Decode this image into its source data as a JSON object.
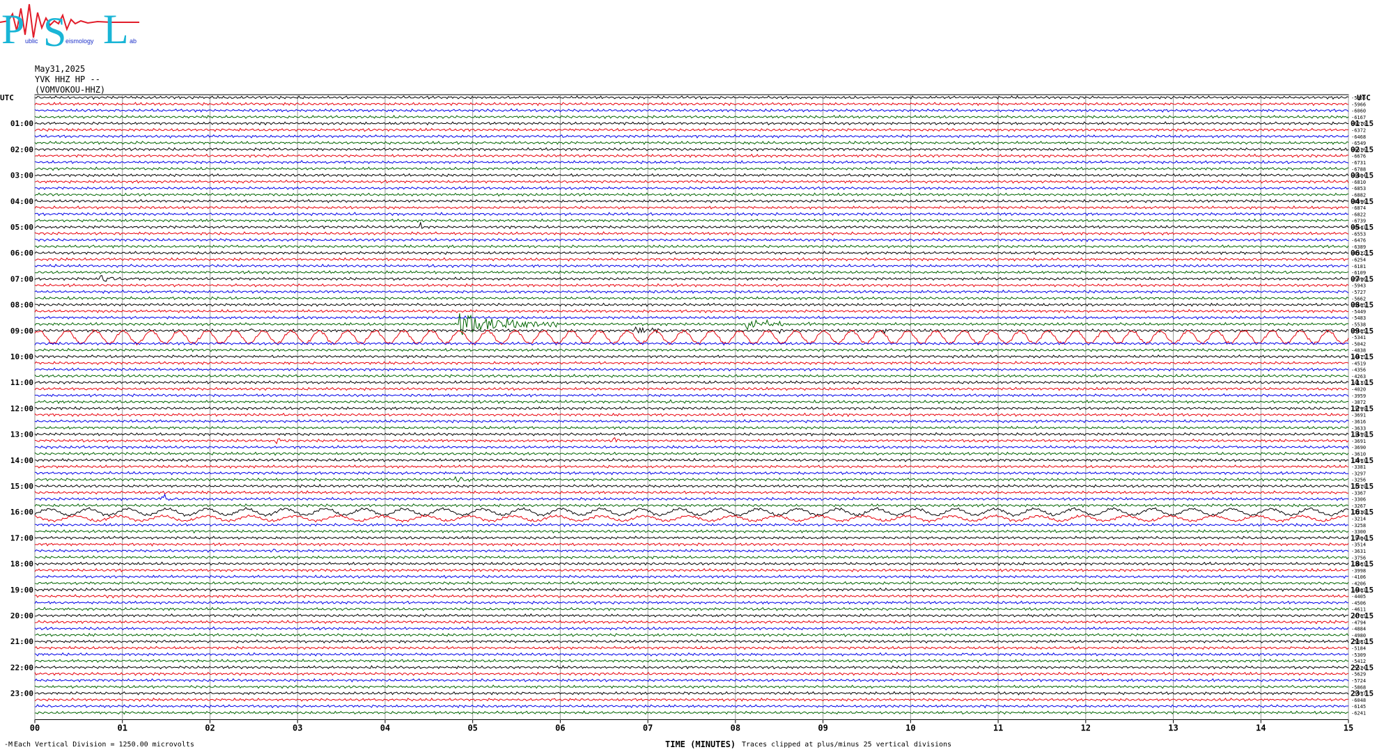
{
  "logo": {
    "big_letters": [
      "P",
      "S",
      "L"
    ],
    "small_text": [
      "ublic",
      "eismology",
      "ab"
    ],
    "colors": {
      "letters": "#19b5d6",
      "small": "#1b2fc9",
      "wave": "#e11d2a"
    }
  },
  "header": {
    "date": "May31,2025",
    "station": "YVK HHZ HP --",
    "code": "(VOMVOKOU-HHZ)"
  },
  "footer": {
    "xlabel": "TIME (MINUTES)",
    "scale_note": "Each Vertical Division = 1250.00 microvolts",
    "clip_note": "Traces clipped at plus/minus 25 vertical divisions",
    "corner_mark": "-M"
  },
  "chart_data": {
    "type": "line",
    "title": "",
    "xlabel": "TIME (MINUTES)",
    "ylabel": "UTC",
    "x_ticks": [
      "00",
      "01",
      "02",
      "03",
      "04",
      "05",
      "06",
      "07",
      "08",
      "09",
      "10",
      "11",
      "12",
      "13",
      "14",
      "15"
    ],
    "xlim": [
      0,
      15
    ],
    "left_axis_label": "UTC",
    "right_axis_label": "UTC",
    "left_hour_labels": [
      "01:00",
      "02:00",
      "03:00",
      "04:00",
      "05:00",
      "06:00",
      "07:00",
      "08:00",
      "09:00",
      "10:00",
      "11:00",
      "12:00",
      "13:00",
      "14:00",
      "15:00",
      "16:00",
      "17:00",
      "18:00",
      "19:00",
      "20:00",
      "21:00",
      "22:00",
      "23:00"
    ],
    "right_hour_labels": [
      "01:15",
      "02:15",
      "03:15",
      "04:15",
      "05:15",
      "06:15",
      "07:15",
      "08:15",
      "09:15",
      "10:15",
      "11:15",
      "12:15",
      "13:15",
      "14:15",
      "15:15",
      "16:15",
      "17:15",
      "18:15",
      "19:15",
      "20:15",
      "21:15",
      "22:15",
      "23:15"
    ],
    "trace_colors": [
      "#000000",
      "#e8000b",
      "#0000e8",
      "#006400"
    ],
    "trace_minutes_each": 15,
    "trace_count": 96,
    "trace_offsets": [
      -5965,
      -5966,
      -6060,
      -6167,
      -6270,
      -6372,
      -6468,
      -6549,
      -6616,
      -6676,
      -6731,
      -6788,
      -6804,
      -6810,
      -6853,
      -6882,
      -6896,
      -6874,
      -6822,
      -6739,
      -6643,
      -6553,
      -6476,
      -6389,
      -6322,
      -6254,
      -6181,
      -6109,
      -5996,
      -5943,
      -5727,
      -5662,
      -5605,
      -5449,
      -5483,
      -5538,
      -5505,
      -5341,
      -5042,
      -4838,
      -4675,
      -4519,
      -4356,
      -4263,
      -4133,
      -4020,
      -3959,
      -3872,
      -3799,
      -3691,
      -3616,
      -3633,
      -3659,
      -3691,
      -3690,
      -3610,
      -3493,
      -3381,
      -3297,
      -3256,
      -3279,
      -3367,
      -3306,
      -3267,
      -3230,
      -3214,
      -3258,
      -3300,
      -3404,
      -3514,
      -3631,
      -3756,
      -3863,
      -3998,
      -4106,
      -4206,
      -4303,
      -4405,
      -4506,
      -4611,
      -4705,
      -4794,
      -4884,
      -4980,
      -5081,
      -5184,
      -5309,
      -5412,
      -5524,
      -5629,
      -5724,
      -5868,
      -5957,
      -6048,
      -6145,
      -6241
    ],
    "events": [
      {
        "trace": 20,
        "minute": 4.4,
        "amp": 5,
        "dur": 0.06
      },
      {
        "trace": 28,
        "minute": 0.75,
        "amp": 3.5,
        "dur": 0.45
      },
      {
        "trace": 35,
        "minute": 4.85,
        "amp": 11,
        "dur": 1.6
      },
      {
        "trace": 35,
        "minute": 8.1,
        "amp": 6,
        "dur": 0.9
      },
      {
        "trace": 36,
        "minute": 2.45,
        "amp": 3,
        "dur": 0.1
      },
      {
        "trace": 36,
        "minute": 6.85,
        "amp": 4,
        "dur": 0.7
      },
      {
        "trace": 36,
        "minute": 8.5,
        "amp": 4,
        "dur": 0.3
      },
      {
        "trace": 36,
        "minute": 9.7,
        "amp": 4,
        "dur": 0.1
      },
      {
        "trace": 47,
        "minute": 7.25,
        "amp": 3,
        "dur": 0.1
      },
      {
        "trace": 53,
        "minute": 2.75,
        "amp": 3.5,
        "dur": 0.15
      },
      {
        "trace": 53,
        "minute": 6.6,
        "amp": 3.5,
        "dur": 0.2
      },
      {
        "trace": 54,
        "minute": 13.65,
        "amp": 4,
        "dur": 0.08
      },
      {
        "trace": 59,
        "minute": 4.8,
        "amp": 3,
        "dur": 0.4
      },
      {
        "trace": 62,
        "minute": 1.45,
        "amp": 6,
        "dur": 0.15
      },
      {
        "trace": 70,
        "minute": 2.7,
        "amp": 4,
        "dur": 0.1
      },
      {
        "trace": 70,
        "minute": 3.85,
        "amp": 3,
        "dur": 0.1
      },
      {
        "trace": 77,
        "minute": 0.8,
        "amp": 3,
        "dur": 0.12
      },
      {
        "trace": 86,
        "minute": 10.55,
        "amp": 4,
        "dur": 0.25
      }
    ],
    "long_period_traces": [
      {
        "trace": 37,
        "amp": 9,
        "period": 0.32
      },
      {
        "trace": 64,
        "amp": 4.5,
        "period": 0.45
      },
      {
        "trace": 65,
        "amp": 3.5,
        "period": 0.5
      }
    ],
    "grid": true
  }
}
